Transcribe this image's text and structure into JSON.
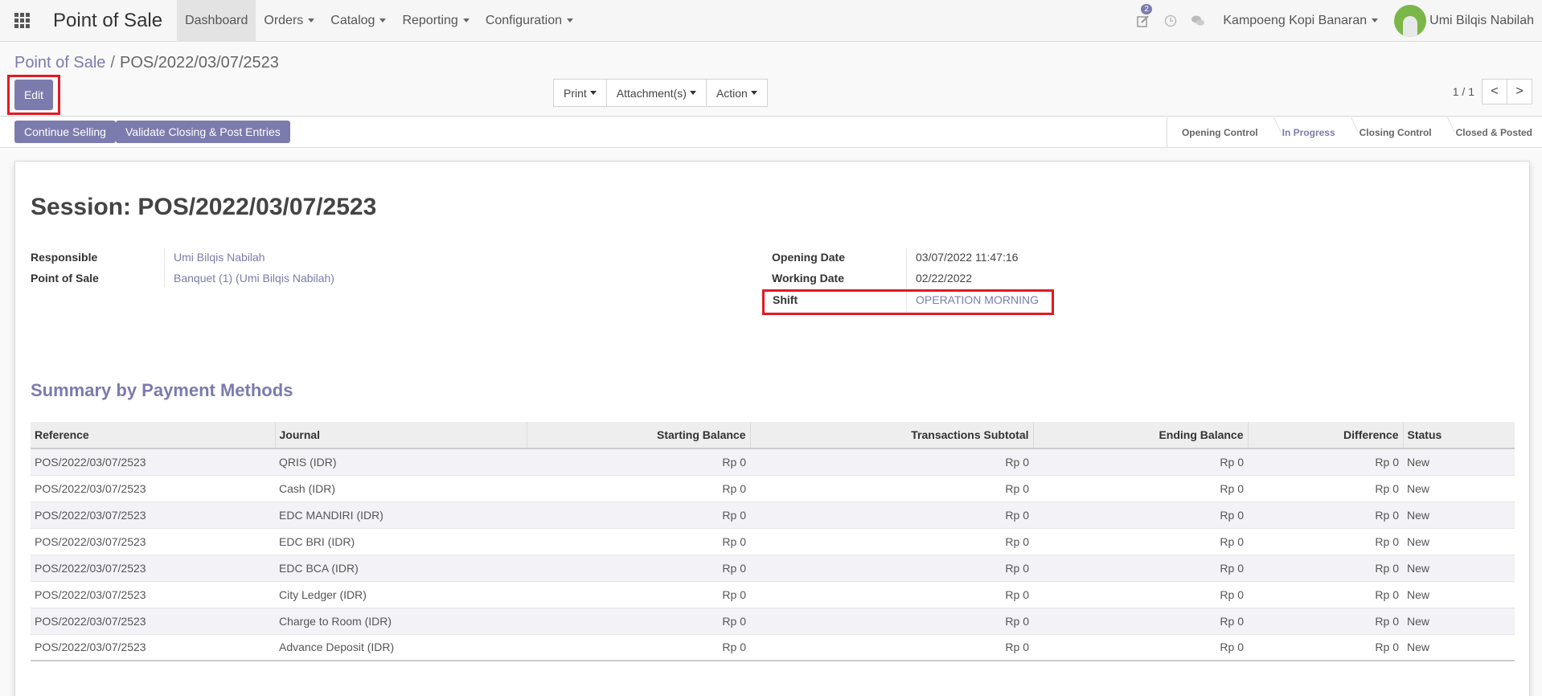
{
  "navbar": {
    "brand": "Point of Sale",
    "menu": [
      {
        "label": "Dashboard",
        "active": true
      },
      {
        "label": "Orders",
        "dropdown": true
      },
      {
        "label": "Catalog",
        "dropdown": true
      },
      {
        "label": "Reporting",
        "dropdown": true
      },
      {
        "label": "Configuration",
        "dropdown": true
      }
    ],
    "activity_count": "2",
    "company": "Kampoeng Kopi Banaran",
    "user": "Umi Bilqis Nabilah"
  },
  "breadcrumb": {
    "parent": "Point of Sale",
    "separator": "/",
    "current": "POS/2022/03/07/2523"
  },
  "toolbar": {
    "edit": "Edit",
    "print": "Print",
    "attachments": "Attachment(s)",
    "action": "Action",
    "pager": "1 / 1",
    "prev": "<",
    "next": ">"
  },
  "statusbar": {
    "continue": "Continue Selling",
    "validate": "Validate Closing & Post Entries",
    "stages": [
      {
        "label": "Opening Control",
        "active": false
      },
      {
        "label": "In Progress",
        "active": true
      },
      {
        "label": "Closing Control",
        "active": false
      },
      {
        "label": "Closed & Posted",
        "active": false
      }
    ]
  },
  "session": {
    "title": "Session: POS/2022/03/07/2523",
    "responsible_label": "Responsible",
    "responsible": "Umi Bilqis Nabilah",
    "pos_label": "Point of Sale",
    "pos": "Banquet (1) (Umi Bilqis Nabilah)",
    "opening_label": "Opening Date",
    "opening": "03/07/2022 11:47:16",
    "working_label": "Working Date",
    "working": "02/22/2022",
    "shift_label": "Shift",
    "shift": "OPERATION MORNING"
  },
  "summary": {
    "title": "Summary by Payment Methods",
    "columns": [
      "Reference",
      "Journal",
      "Starting Balance",
      "Transactions Subtotal",
      "Ending Balance",
      "Difference",
      "Status"
    ],
    "rows": [
      [
        "POS/2022/03/07/2523",
        "QRIS (IDR)",
        "Rp 0",
        "Rp 0",
        "Rp 0",
        "Rp 0",
        "New"
      ],
      [
        "POS/2022/03/07/2523",
        "Cash (IDR)",
        "Rp 0",
        "Rp 0",
        "Rp 0",
        "Rp 0",
        "New"
      ],
      [
        "POS/2022/03/07/2523",
        "EDC MANDIRI (IDR)",
        "Rp 0",
        "Rp 0",
        "Rp 0",
        "Rp 0",
        "New"
      ],
      [
        "POS/2022/03/07/2523",
        "EDC BRI (IDR)",
        "Rp 0",
        "Rp 0",
        "Rp 0",
        "Rp 0",
        "New"
      ],
      [
        "POS/2022/03/07/2523",
        "EDC BCA (IDR)",
        "Rp 0",
        "Rp 0",
        "Rp 0",
        "Rp 0",
        "New"
      ],
      [
        "POS/2022/03/07/2523",
        "City Ledger (IDR)",
        "Rp 0",
        "Rp 0",
        "Rp 0",
        "Rp 0",
        "New"
      ],
      [
        "POS/2022/03/07/2523",
        "Charge to Room (IDR)",
        "Rp 0",
        "Rp 0",
        "Rp 0",
        "Rp 0",
        "New"
      ],
      [
        "POS/2022/03/07/2523",
        "Advance Deposit (IDR)",
        "Rp 0",
        "Rp 0",
        "Rp 0",
        "Rp 0",
        "New"
      ]
    ]
  },
  "colors": {
    "accent": "#7c7bad",
    "highlight": "#e01b24"
  }
}
